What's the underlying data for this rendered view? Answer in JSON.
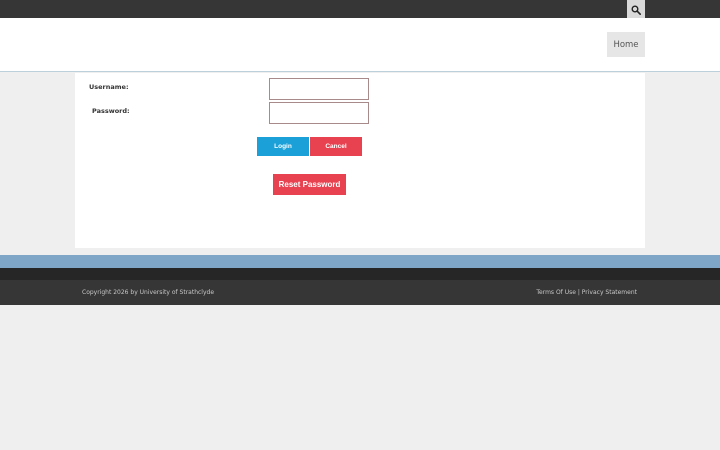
{
  "topbar": {
    "search_icon": "search-icon"
  },
  "header": {
    "home_label": "Home"
  },
  "login_form": {
    "username_label": "Username:",
    "username_value": "",
    "password_label": "Password:",
    "password_value": "",
    "login_label": "Login",
    "cancel_label": "Cancel",
    "reset_label": "Reset Password"
  },
  "footer": {
    "copyright": "Copyright 2026 by University of Strathclyde",
    "terms_label": "Terms Of Use",
    "separator": "|",
    "privacy_label": "Privacy Statement"
  },
  "colors": {
    "primary_button": "#1ba0d8",
    "danger_button": "#e8414f",
    "topbar": "#363636",
    "accent_band": "#7fa6c6"
  }
}
